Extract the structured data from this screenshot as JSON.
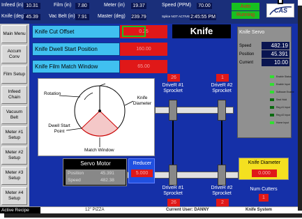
{
  "top": {
    "infeed_label": "Infeed (in)",
    "infeed_value": "10.31",
    "knife_label": "Knife (deg)",
    "knife_value": "45.39",
    "film_label": "Film (in)",
    "film_value": "7.80",
    "vac_label": "Vac Belt (in)",
    "vac_value": "7.91",
    "meter_label": "Meter (in)",
    "meter_value": "19.37",
    "master_label": "Master (deg)",
    "master_value": "239.79",
    "speed_label": "Speed (PPM)",
    "speed_value": "70.00",
    "splice_label": "Splice NOT ACTIVE",
    "time_value": "2:45:55 PM",
    "mode_top": "Auto",
    "mode_bottom": "Running",
    "logo": "CAS"
  },
  "sidebar": [
    {
      "label": "Main Menu"
    },
    {
      "label": "Accum Conv"
    },
    {
      "label": "Film Setup"
    },
    {
      "label": "Infeed Chain"
    },
    {
      "label": "Vacuum Belt"
    },
    {
      "label": "Meter #1 Setup"
    },
    {
      "label": "Meter #2 Setup"
    },
    {
      "label": "Meter #3 Setup"
    },
    {
      "label": "Meter #4 Setup"
    }
  ],
  "params": [
    {
      "label": "Knife Cut Offset",
      "value": "0.25"
    },
    {
      "label": "Knife Dwell Start Position",
      "value": "160.00"
    },
    {
      "label": "Knife Film Match Window",
      "value": "65.00"
    }
  ],
  "title": "Knife",
  "servo": {
    "title": "Knife Servo",
    "speed_label": "Speed",
    "speed_value": "482.19",
    "position_label": "Position",
    "position_value": "45.391",
    "current_label": "Current",
    "current_value": "10.00",
    "leds": [
      {
        "label": "Enable Status",
        "on": true
      },
      {
        "label": "Enable Input",
        "on": true
      },
      {
        "label": "Software Enable",
        "on": true
      },
      {
        "label": "Seal Hold",
        "on": false
      },
      {
        "label": "Reg #1 Input",
        "on": false
      },
      {
        "label": "Reg #2 Input",
        "on": false
      },
      {
        "label": "Home Input",
        "on": true
      }
    ]
  },
  "diagram": {
    "rotation": "Rotation",
    "knife_diameter": "Knife Diameter",
    "dwell_start": "Dwell Start Point",
    "match_window": "Match Window"
  },
  "drive1_top": {
    "value": "26",
    "label": "DriveR #1 Sprocket"
  },
  "drive2_top": {
    "value": "1",
    "label": "DriveR #2 Sprocket"
  },
  "drive1_bot": {
    "value": "26",
    "label": "DriveR #1 Sprocket"
  },
  "drive2_bot": {
    "value": "2",
    "label": "DriveR #2 Sprocket"
  },
  "motor": {
    "title": "Servo Motor",
    "position_label": "Position",
    "position_value": "45.391",
    "speed_label": "Speed",
    "speed_value": "482.38"
  },
  "reducer": {
    "title": "Reducer",
    "value": "5.000"
  },
  "knife_diameter": {
    "title": "Knife Diameter",
    "value": "0.000"
  },
  "cutters": {
    "title": "Num Cutters",
    "value": "1"
  },
  "status": {
    "recipe_label": "Active Recipe",
    "recipe": "12\" PIZZA",
    "user": "Current User: DANNY",
    "system": "Knife System"
  }
}
